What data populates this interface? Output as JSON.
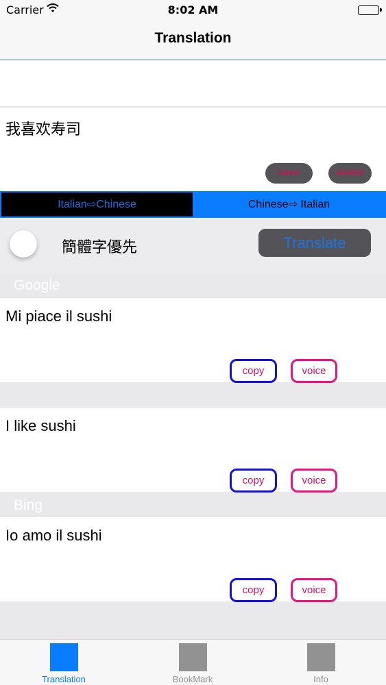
{
  "status_bar": {
    "carrier": "Carrier",
    "time": "8:02 AM"
  },
  "nav": {
    "title": "Translation"
  },
  "input": {
    "text": "我喜欢寿司",
    "save_label": "save",
    "delete_label": "delete"
  },
  "segmented": {
    "options": [
      "Italian⇨Chinese",
      "Chinese⇨ Italian"
    ],
    "selected_index": 0
  },
  "controls": {
    "toggle_label": "簡體字優先",
    "toggle_on": false,
    "translate_label": "Translate"
  },
  "sections": {
    "google": "Google",
    "bing": "Bing"
  },
  "results": [
    {
      "text": "Mi piace il sushi",
      "copy_label": "copy",
      "voice_label": "voice"
    },
    {
      "text": "I like sushi",
      "copy_label": "copy",
      "voice_label": "voice"
    },
    {
      "text": "Io amo il sushi",
      "copy_label": "copy",
      "voice_label": "voice"
    }
  ],
  "tab_bar": {
    "items": [
      {
        "label": "Translation",
        "selected": true
      },
      {
        "label": "BookMark",
        "selected": false
      },
      {
        "label": "Info",
        "selected": false
      }
    ]
  },
  "colors": {
    "accent": "#0a7cff",
    "copy_border": "#1111dd",
    "voice_border": "#e8157e",
    "button_text": "#d4145a",
    "dark_button": "#545458"
  }
}
